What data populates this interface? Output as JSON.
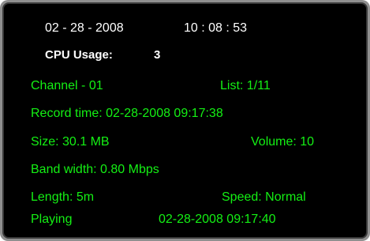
{
  "header": {
    "date": "02 - 28 - 2008",
    "time": "10 : 08 : 53",
    "cpu_label": "CPU Usage:",
    "cpu_value": "3"
  },
  "info": {
    "channel": "Channel - 01",
    "list": "List: 1/11",
    "record_time": "Record time: 02-28-2008 09:17:38",
    "size": "Size: 30.1 MB",
    "volume": "Volume: 10",
    "bandwidth": "Band width: 0.80 Mbps",
    "length": "Length: 5m",
    "speed": "Speed: Normal",
    "status": "Playing",
    "play_timestamp": "02-28-2008 09:17:40"
  },
  "colors": {
    "background": "#000000",
    "frame": "#8f8f8f",
    "header_text": "#ffffff",
    "info_text": "#14f014"
  }
}
